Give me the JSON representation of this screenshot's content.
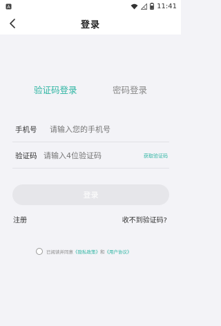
{
  "status_bar": {
    "time": "11:41",
    "left_icon": "notification-a-icon",
    "icons": [
      "wifi-icon",
      "signal-off-icon",
      "battery-icon"
    ]
  },
  "nav": {
    "title": "登录",
    "back_icon": "chevron-left-icon"
  },
  "tabs": {
    "code_login": "验证码登录",
    "password_login": "密码登录",
    "active": "code_login"
  },
  "form": {
    "phone_label": "手机号",
    "phone_placeholder": "请输入您的手机号",
    "code_label": "验证码",
    "code_placeholder": "请输入4位验证码",
    "get_code": "获取验证码"
  },
  "login_button": "登录",
  "register_link": "注册",
  "no_code_link": "收不到验证码?",
  "agreement": {
    "prefix": "已阅读并同意",
    "privacy": "《隐私政策》",
    "and": "和",
    "user": "《用户协议》"
  },
  "colors": {
    "accent": "#2fb5a3",
    "background": "#f3f3f7",
    "button_disabled": "#e6e6ea"
  }
}
